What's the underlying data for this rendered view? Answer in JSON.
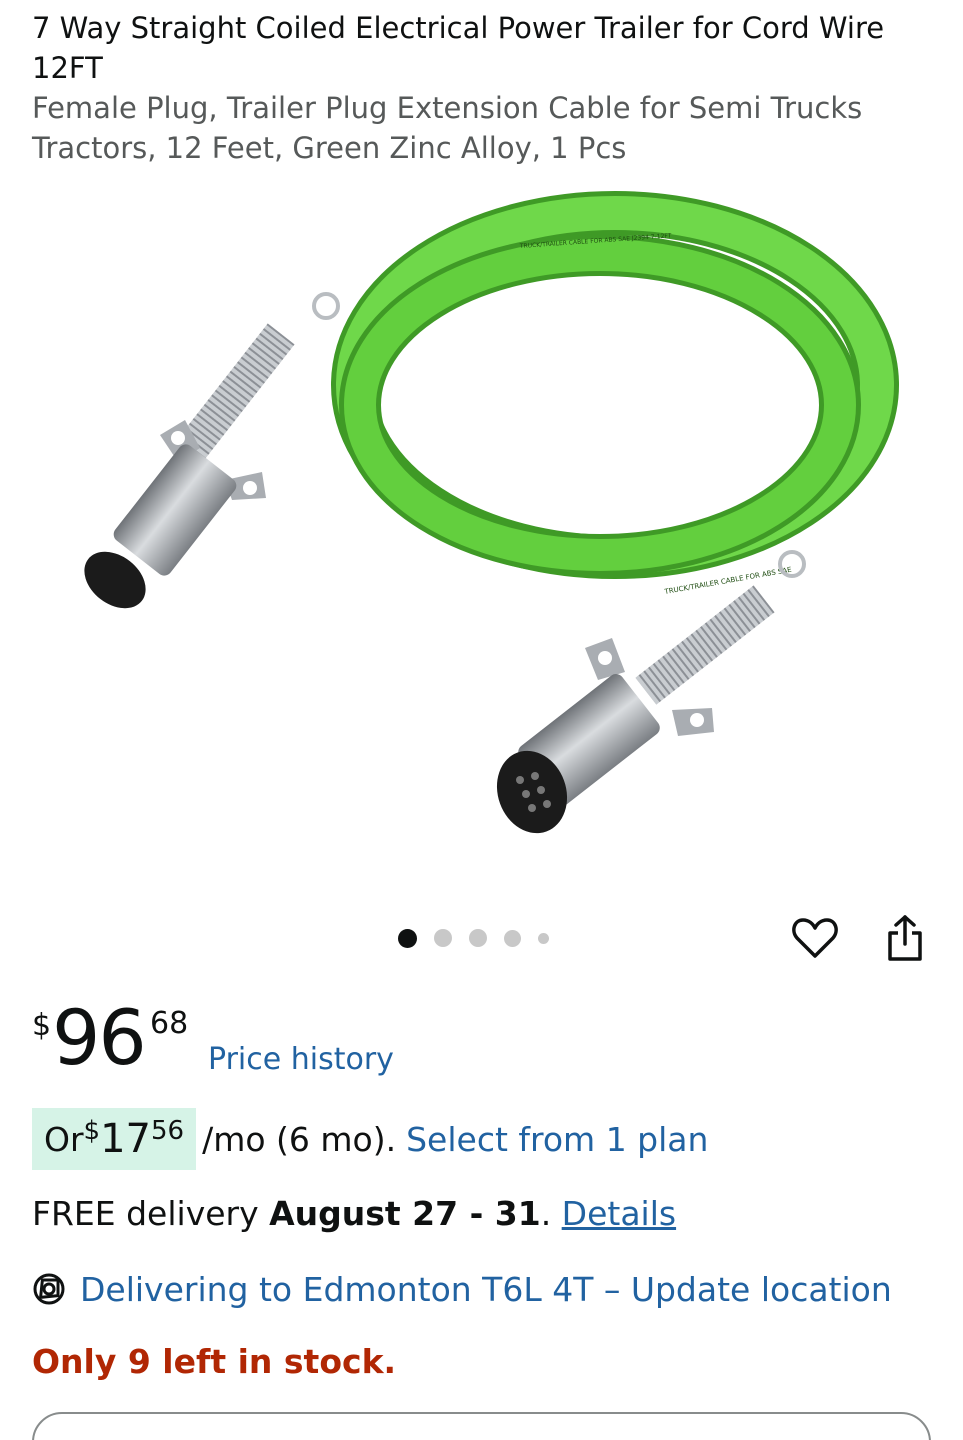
{
  "product": {
    "title": "7 Way Straight Coiled Electrical Power Trailer for Cord Wire 12FT",
    "subtitle": "Female Plug, Trailer Plug Extension Cable for Semi Trucks Tractors, 12 Feet, Green Zinc Alloy, 1 Pcs"
  },
  "image": {
    "cable_text_1": "TRUCK/TRAILER CABLE FOR ABS SAE J2394 7-12FT",
    "cable_text_2": "TRUCK/TRAILER CABLE FOR ABS SAE",
    "carousel_count": 5,
    "carousel_active_index": 0
  },
  "icons": {
    "heart": "heart-icon",
    "share": "share-icon",
    "location": "location-pin-icon"
  },
  "price": {
    "currency": "$",
    "whole": "96",
    "fraction": "68",
    "history_label": "Price history"
  },
  "installment": {
    "prefix": "Or ",
    "currency": "$",
    "whole": "17",
    "fraction": "56",
    "suffix": "/mo (6 mo).",
    "link": "Select from 1 plan"
  },
  "delivery": {
    "prefix": "FREE delivery ",
    "dates": "August 27 - 31",
    "period": ". ",
    "details_link": "Details"
  },
  "location": {
    "text": "Delivering to Edmonton T6L 4T – Update location"
  },
  "stock": {
    "text": "Only 9 left in stock."
  },
  "colors": {
    "link": "#2162a1",
    "stock_alert": "#b12704",
    "installment_bg": "#d6f3e7",
    "cable_green": "#5cc83a"
  }
}
